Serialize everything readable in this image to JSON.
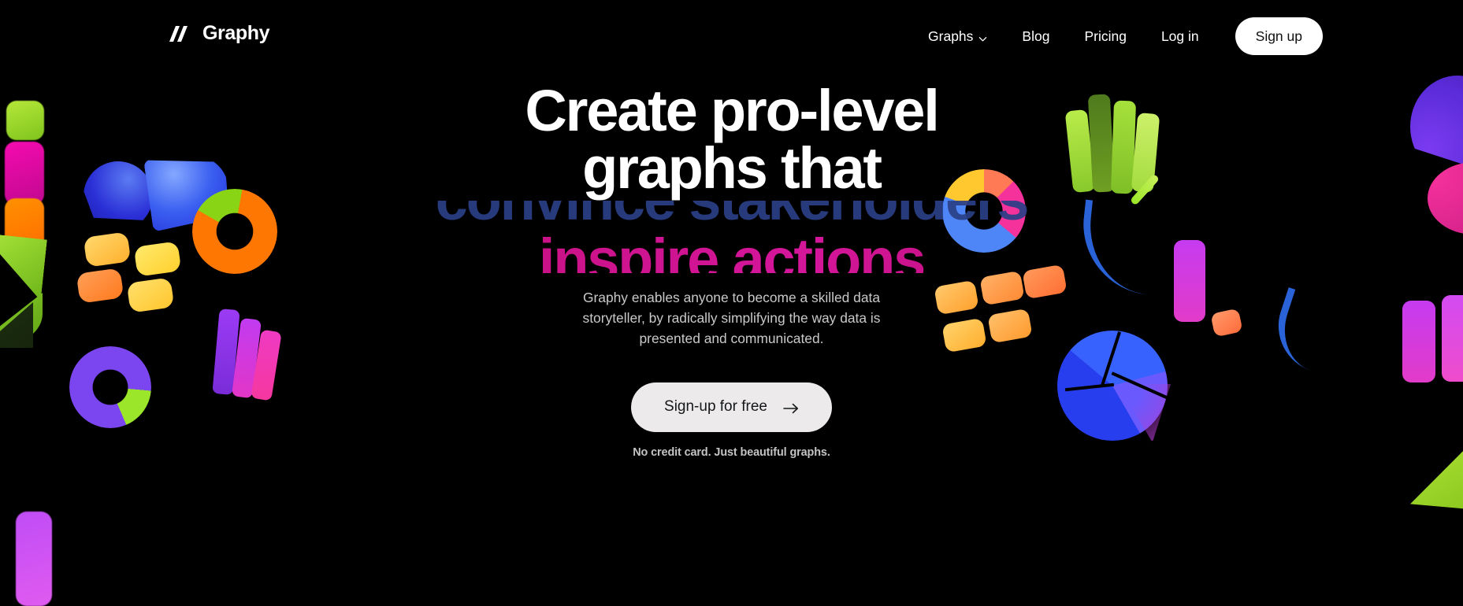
{
  "header": {
    "logo": {
      "text": "Graphy",
      "mark_icon": "graphy-slashes-logo"
    },
    "nav": [
      {
        "label": "Graphs",
        "icon": "chevron-down-icon",
        "has_dropdown": true
      },
      {
        "label": "Blog",
        "has_dropdown": false
      },
      {
        "label": "Pricing",
        "has_dropdown": false
      },
      {
        "label": "Log in",
        "has_dropdown": false
      }
    ],
    "signup_button": {
      "label": "Sign up"
    }
  },
  "hero": {
    "headline_line1": "Create pro-level",
    "headline_line2": "graphs that",
    "rotating_text_outgoing": "convince stakeholders",
    "rotating_text_incoming": "inspire actions",
    "subtitle": "Graphy enables anyone to become a skilled data storyteller, by radically simplifying the way data is presented and communicated.",
    "cta": {
      "label": "Sign-up for free",
      "icon": "arrow-right-icon"
    },
    "fineprint": "No credit card. Just beautiful graphs."
  },
  "colors": {
    "background": "#000000",
    "headline": "#ffffff",
    "rotating_outgoing": "#2b3f86",
    "rotating_incoming": "#c8127f",
    "subtitle": "#c9c9c9",
    "cta_background": "#eceaea",
    "cta_text": "#15171a",
    "signup_background": "#ffffff",
    "nav_link": "#ffffff"
  },
  "decorations": {
    "description": "3D-rendered colorful chart shapes (pie slices, donut charts, bar columns, rounded tiles, trend lines) scattered on both sides of the hero",
    "left_items": [
      "green-bar",
      "magenta-bar",
      "orange-bar",
      "blue-pie-slices",
      "yellow-orange-tile-grid",
      "orange-green-donut",
      "green-pie-slices",
      "purple-green-donut",
      "purple-pink-bars",
      "violet-bar"
    ],
    "right_items": [
      "rainbow-donut",
      "green-bar-group",
      "orange-tile-grid",
      "blue-trend-line",
      "green-tick",
      "magenta-bars",
      "purple-wedge",
      "blue-pie-chart",
      "lime-pie-slice"
    ]
  }
}
